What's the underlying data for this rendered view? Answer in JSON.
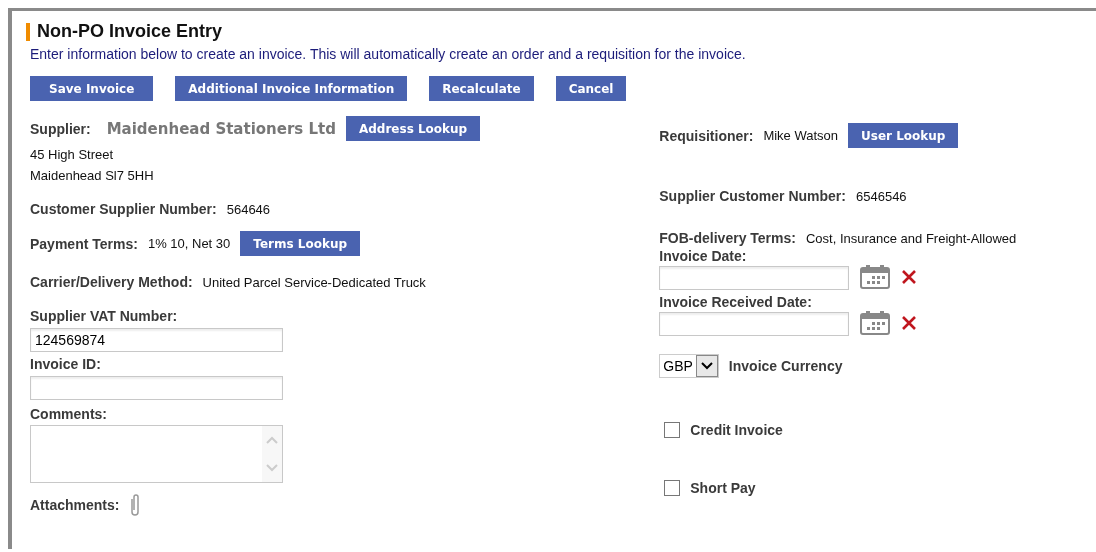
{
  "title": "Non-PO Invoice Entry",
  "intro": "Enter information below to create an invoice. This will automatically create an order and a requisition for the invoice.",
  "buttons": [
    "Save Invoice",
    "Additional Invoice Information",
    "Recalculate",
    "Cancel"
  ],
  "left": [
    {
      "kind": "supplier",
      "label": "Supplier:",
      "value": "Maidenhead Stationers Ltd",
      "button": "Address Lookup",
      "address": [
        "45 High Street",
        "Maidenhead Sl7 5HH"
      ]
    },
    {
      "kind": "info",
      "label": "Customer Supplier Number:",
      "value": "564646"
    },
    {
      "kind": "info",
      "label": "Payment Terms:",
      "value": "1% 10, Net 30",
      "button": "Terms Lookup"
    },
    {
      "kind": "info",
      "label": "Carrier/Delivery Method:",
      "value": "United Parcel Service-Dedicated Truck"
    },
    {
      "kind": "text_field",
      "label": "Supplier VAT Number:",
      "value": "124569874"
    },
    {
      "kind": "text_field",
      "label": "Invoice ID:"
    },
    {
      "kind": "textarea",
      "label": "Comments:"
    },
    {
      "kind": "attachment",
      "label": "Attachments:"
    }
  ],
  "right": [
    {
      "kind": "info",
      "label": "Requisitioner:",
      "value": "Mike Watson",
      "button": "User Lookup"
    },
    {
      "kind": "info",
      "label": "Supplier Customer Number:",
      "value": "6546546"
    },
    {
      "kind": "info",
      "label": "FOB-delivery Terms:",
      "value": "Cost, Insurance and Freight-Allowed"
    },
    {
      "kind": "date_field",
      "label": "Invoice Date:"
    },
    {
      "kind": "date_field",
      "label": "Invoice Received Date:"
    },
    {
      "kind": "select",
      "value": "GBP",
      "label": "Invoice Currency"
    },
    {
      "kind": "checkbox",
      "label": "Credit Invoice",
      "checked": false
    },
    {
      "kind": "checkbox",
      "label": "Short Pay",
      "checked": false
    }
  ]
}
